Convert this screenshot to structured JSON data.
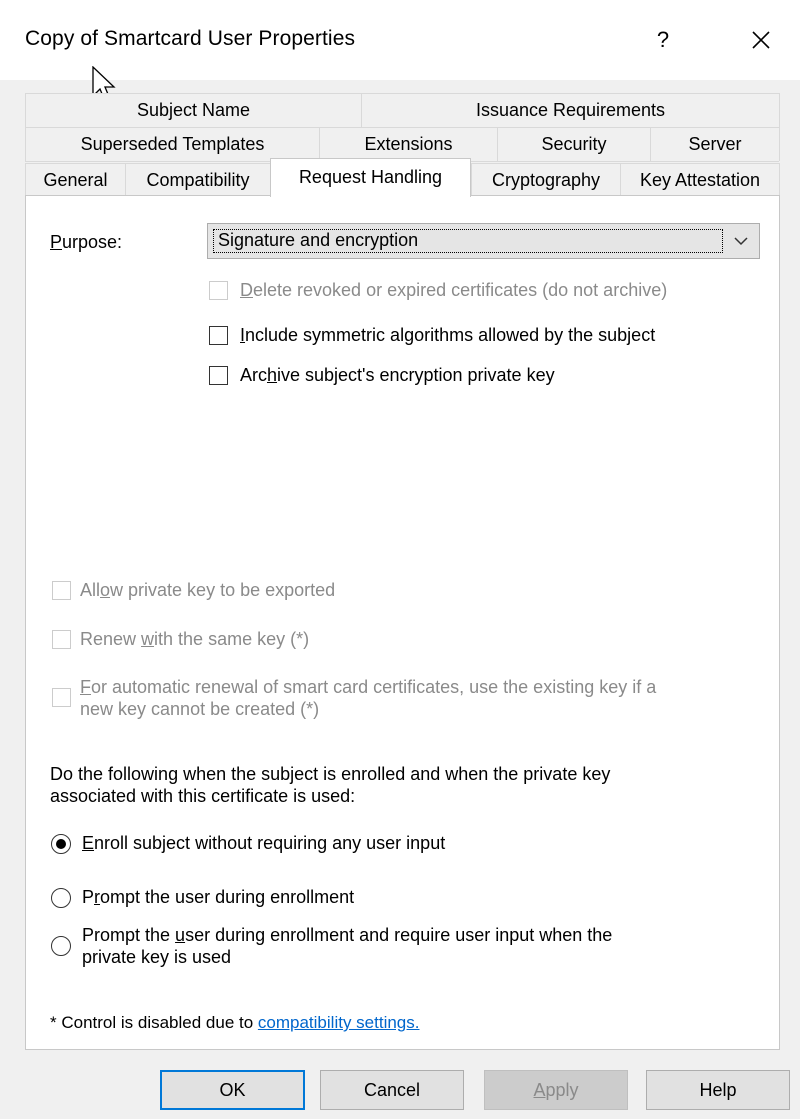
{
  "window": {
    "title": "Copy of Smartcard User Properties",
    "help_label": "?",
    "close_icon": "close-icon"
  },
  "tabs": {
    "row1": [
      "Subject Name",
      "Issuance Requirements"
    ],
    "row2": [
      "Superseded Templates",
      "Extensions",
      "Security",
      "Server"
    ],
    "row3": [
      "General",
      "Compatibility",
      "Request Handling",
      "Cryptography",
      "Key Attestation"
    ],
    "selected": "Request Handling"
  },
  "purpose": {
    "label_first": "P",
    "label_rest": "urpose:",
    "value": "Signature and encryption"
  },
  "options": {
    "delete_revoked": {
      "u": "D",
      "rest": "elete revoked or expired certificates (do not archive)",
      "checked": false,
      "enabled": false
    },
    "include_symmetric": {
      "u": "I",
      "rest": "nclude symmetric algorithms allowed by the subject",
      "checked": false,
      "enabled": true
    },
    "archive_key": {
      "pre": "Arc",
      "u": "h",
      "rest": "ive subject's encryption private key",
      "checked": false,
      "enabled": true
    },
    "allow_export": {
      "pre": "All",
      "u": "o",
      "rest": "w private key to be exported",
      "checked": false,
      "enabled": false
    },
    "renew_same_key": {
      "pre": "Renew ",
      "u": "w",
      "rest": "ith the same key (*)",
      "checked": false,
      "enabled": false
    },
    "auto_renewal": {
      "u": "F",
      "rest_line1": "or automatic renewal of smart card certificates, use the existing key if a",
      "line2": "new key cannot be created (*)",
      "checked": false,
      "enabled": false
    }
  },
  "enrollment": {
    "intro_line1": "Do the following when the subject is enrolled and when the private key",
    "intro_line2": "associated with this certificate is used:",
    "radio1": {
      "u": "E",
      "rest": "nroll subject without requiring any user input",
      "checked": true
    },
    "radio2": {
      "pre": "P",
      "u": "r",
      "rest": "ompt the user during enrollment",
      "checked": false
    },
    "radio3": {
      "pre": "Prompt the ",
      "u": "u",
      "rest_line1": "ser during enrollment and require user input when the",
      "line2": "private key is used",
      "checked": false
    }
  },
  "footnote": {
    "text": "* Control is disabled due to ",
    "link": "compatibility settings."
  },
  "buttons": {
    "ok": "OK",
    "cancel": "Cancel",
    "apply_u": "A",
    "apply_rest": "pply",
    "help": "Help"
  }
}
